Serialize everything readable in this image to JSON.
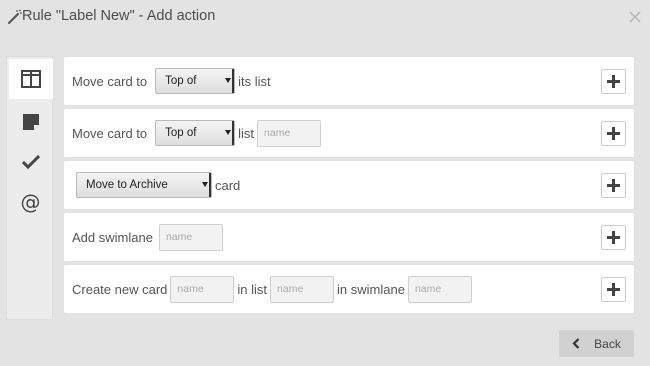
{
  "header": {
    "title": "Rule \"Label New\" - Add action",
    "title_icon": "magic-wand-icon",
    "close_icon": "close-icon"
  },
  "sidebar": {
    "items": [
      {
        "icon": "columns-icon",
        "active": true
      },
      {
        "icon": "sticky-note-icon",
        "active": false
      },
      {
        "icon": "check-icon",
        "active": false
      },
      {
        "icon": "at-icon",
        "active": false
      }
    ]
  },
  "actions": {
    "move_top": {
      "label": "Move card to",
      "select_value": "Top of",
      "suffix": "its list"
    },
    "move_list": {
      "label": "Move card to",
      "select_value": "Top of",
      "list_label": "list",
      "name_placeholder": "name"
    },
    "archive": {
      "select_value": "Move to Archive",
      "suffix": "card"
    },
    "swimlane": {
      "label": "Add swimlane",
      "name_placeholder": "name"
    },
    "create_card": {
      "label": "Create new card",
      "name_placeholder": "name",
      "in_list_label": "in list",
      "list_placeholder": "name",
      "in_swimlane_label": "in swimlane",
      "swimlane_placeholder": "name"
    },
    "add_icon": "plus-icon"
  },
  "footer": {
    "back_label": "Back",
    "back_icon": "chevron-left-icon"
  },
  "colors": {
    "background": "#e3e3e3",
    "row_background": "#ffffff",
    "text": "#555555",
    "button": "#d1d1d1"
  }
}
